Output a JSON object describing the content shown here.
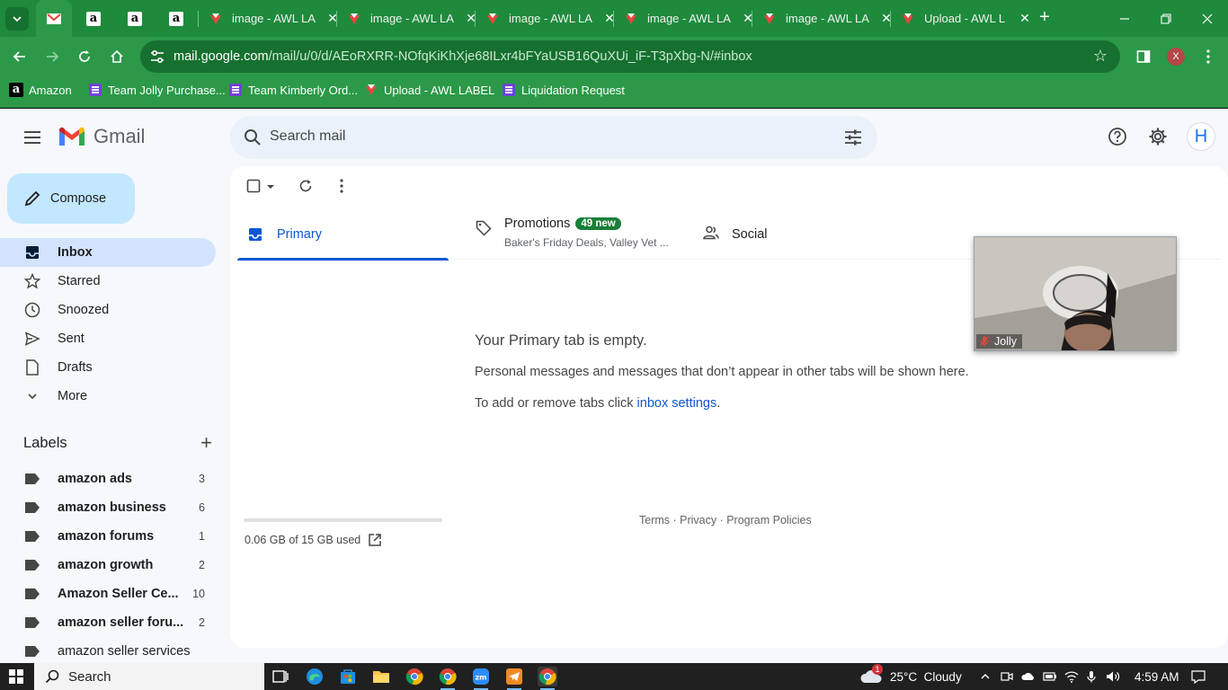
{
  "browser": {
    "tabs": [
      {
        "title": ""
      },
      {
        "title": ""
      },
      {
        "title": ""
      },
      {
        "title": "image - AWL LA"
      },
      {
        "title": "image - AWL LA"
      },
      {
        "title": "image - AWL LA"
      },
      {
        "title": "image - AWL LA"
      },
      {
        "title": "image - AWL LA"
      },
      {
        "title": "Upload - AWL L"
      }
    ],
    "url_host": "mail.google.com",
    "url_path": "/mail/u/0/d/AEoRXRR-NOfqKiKhXje68ILxr4bFYaUSB16QuXUi_iF-T3pXbg-N/#inbox",
    "profile_initial": "X",
    "bookmarks": [
      {
        "label": "Amazon"
      },
      {
        "label": "Team Jolly Purchase..."
      },
      {
        "label": "Team Kimberly Ord..."
      },
      {
        "label": "Upload - AWL LABEL"
      },
      {
        "label": "Liquidation Request"
      }
    ]
  },
  "gmail": {
    "logo_text": "Gmail",
    "search_placeholder": "Search mail",
    "avatar_initial": "H",
    "compose_label": "Compose",
    "nav": [
      {
        "label": "Inbox",
        "icon": "inbox-icon"
      },
      {
        "label": "Starred",
        "icon": "star-icon"
      },
      {
        "label": "Snoozed",
        "icon": "clock-icon"
      },
      {
        "label": "Sent",
        "icon": "send-icon"
      },
      {
        "label": "Drafts",
        "icon": "draft-icon"
      },
      {
        "label": "More",
        "icon": "chevron-down-icon"
      }
    ],
    "labels_title": "Labels",
    "labels": [
      {
        "name": "amazon ads",
        "count": "3"
      },
      {
        "name": "amazon business",
        "count": "6"
      },
      {
        "name": "amazon forums",
        "count": "1"
      },
      {
        "name": "amazon growth",
        "count": "2"
      },
      {
        "name": "Amazon Seller Ce...",
        "count": "10"
      },
      {
        "name": "amazon seller foru...",
        "count": "2"
      },
      {
        "name": "amazon seller services",
        "count": ""
      }
    ],
    "tabs": {
      "primary": "Primary",
      "promotions": "Promotions",
      "promotions_badge": "49 new",
      "promotions_snippet": "Baker's Friday Deals, Valley Vet ...",
      "social": "Social"
    },
    "empty": {
      "title": "Your Primary tab is empty.",
      "line1": "Personal messages and messages that don’t appear in other tabs will be shown here.",
      "line2_prefix": "To add or remove tabs click ",
      "line2_link": "inbox settings",
      "line2_suffix": "."
    },
    "storage": {
      "text": "0.06 GB of 15 GB used",
      "used_fraction": 0.004
    },
    "footer": "Terms · Privacy · Program Policies",
    "video_overlay_name": "Jolly"
  },
  "taskbar": {
    "search_label": "Search",
    "weather": "25°C  Cloudy",
    "weather_badge": "1",
    "time": "4:59 AM"
  },
  "colors": {
    "chrome_frame": "#1e8a3c",
    "chrome_toolbar": "#2b9948",
    "gmail_bg": "#f6f8fc",
    "compose_bg": "#c2e7ff",
    "inbox_active": "#d3e3fd",
    "primary_accent": "#0b57d0",
    "promo_badge": "#188038"
  }
}
